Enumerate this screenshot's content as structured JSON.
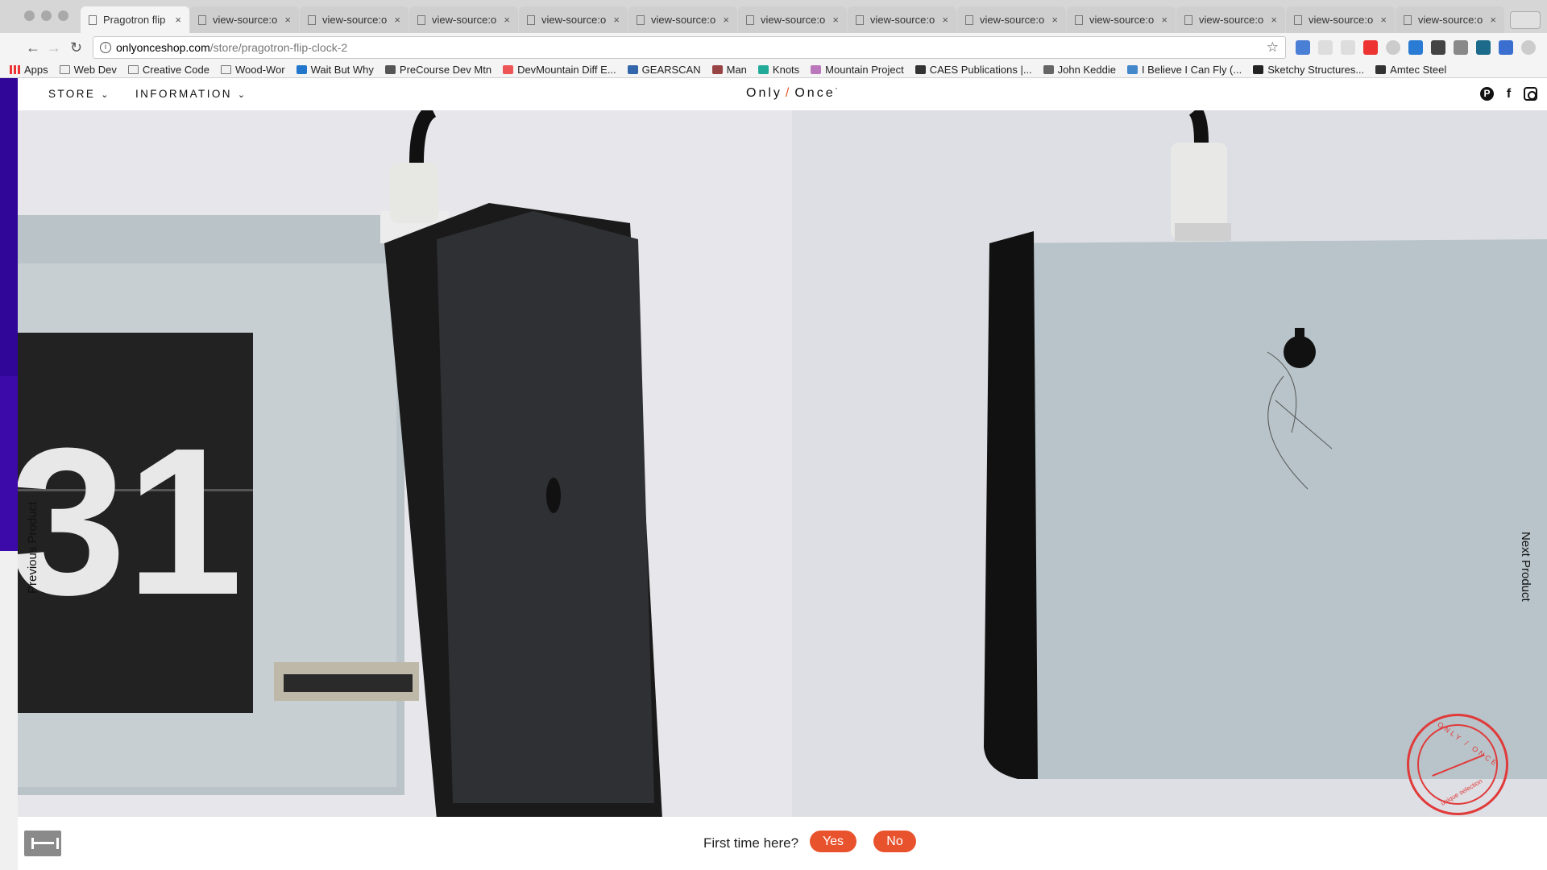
{
  "browser": {
    "tabs": [
      {
        "title": "Pragotron flip",
        "active": true
      },
      {
        "title": "view-source:o",
        "active": false
      },
      {
        "title": "view-source:o",
        "active": false
      },
      {
        "title": "view-source:o",
        "active": false
      },
      {
        "title": "view-source:o",
        "active": false
      },
      {
        "title": "view-source:o",
        "active": false
      },
      {
        "title": "view-source:o",
        "active": false
      },
      {
        "title": "view-source:o",
        "active": false
      },
      {
        "title": "view-source:o",
        "active": false
      },
      {
        "title": "view-source:o",
        "active": false
      },
      {
        "title": "view-source:o",
        "active": false
      },
      {
        "title": "view-source:o",
        "active": false
      },
      {
        "title": "view-source:o",
        "active": false
      }
    ],
    "tab_close_glyph": "×",
    "url_host": "onlyonceshop.com",
    "url_path": "/store/pragotron-flip-clock-2",
    "bookmarks": [
      {
        "label": "Apps",
        "icon": "apps-grid-icon"
      },
      {
        "label": "Web Dev",
        "icon": "folder-icon"
      },
      {
        "label": "Creative Code",
        "icon": "folder-icon"
      },
      {
        "label": "Wood-Wor",
        "icon": "folder-icon"
      },
      {
        "label": "Wait But Why",
        "icon": "site-icon"
      },
      {
        "label": "PreCourse Dev Mtn",
        "icon": "site-icon"
      },
      {
        "label": "DevMountain Diff E...",
        "icon": "site-icon"
      },
      {
        "label": "GEARSCAN",
        "icon": "site-icon"
      },
      {
        "label": "Man",
        "icon": "site-icon"
      },
      {
        "label": "Knots",
        "icon": "site-icon"
      },
      {
        "label": "Mountain Project",
        "icon": "site-icon"
      },
      {
        "label": "CAES Publications |...",
        "icon": "site-icon"
      },
      {
        "label": "John Keddie",
        "icon": "site-icon"
      },
      {
        "label": "I Believe I Can Fly (...",
        "icon": "site-icon"
      },
      {
        "label": "Sketchy Structures...",
        "icon": "site-icon"
      },
      {
        "label": "Amtec Steel",
        "icon": "site-icon"
      }
    ]
  },
  "site": {
    "nav": {
      "store": "STORE",
      "information": "INFORMATION",
      "chevron": "⌄"
    },
    "logo": {
      "left": "Only",
      "slash": "/",
      "right": "Once",
      "mark": "°"
    },
    "social_icons": [
      "pinterest-icon",
      "facebook-icon",
      "instagram-icon"
    ],
    "gallery": {
      "prev_label": "Previous Product",
      "next_label": "Next Product"
    },
    "stamp": {
      "top_text": "ONLY / ONCE",
      "bottom_text": "unique selection"
    },
    "footer": {
      "question": "First time here?",
      "yes": "Yes",
      "no": "No"
    }
  },
  "colors": {
    "accent": "#e8532e",
    "stamp": "#e03a3a"
  }
}
